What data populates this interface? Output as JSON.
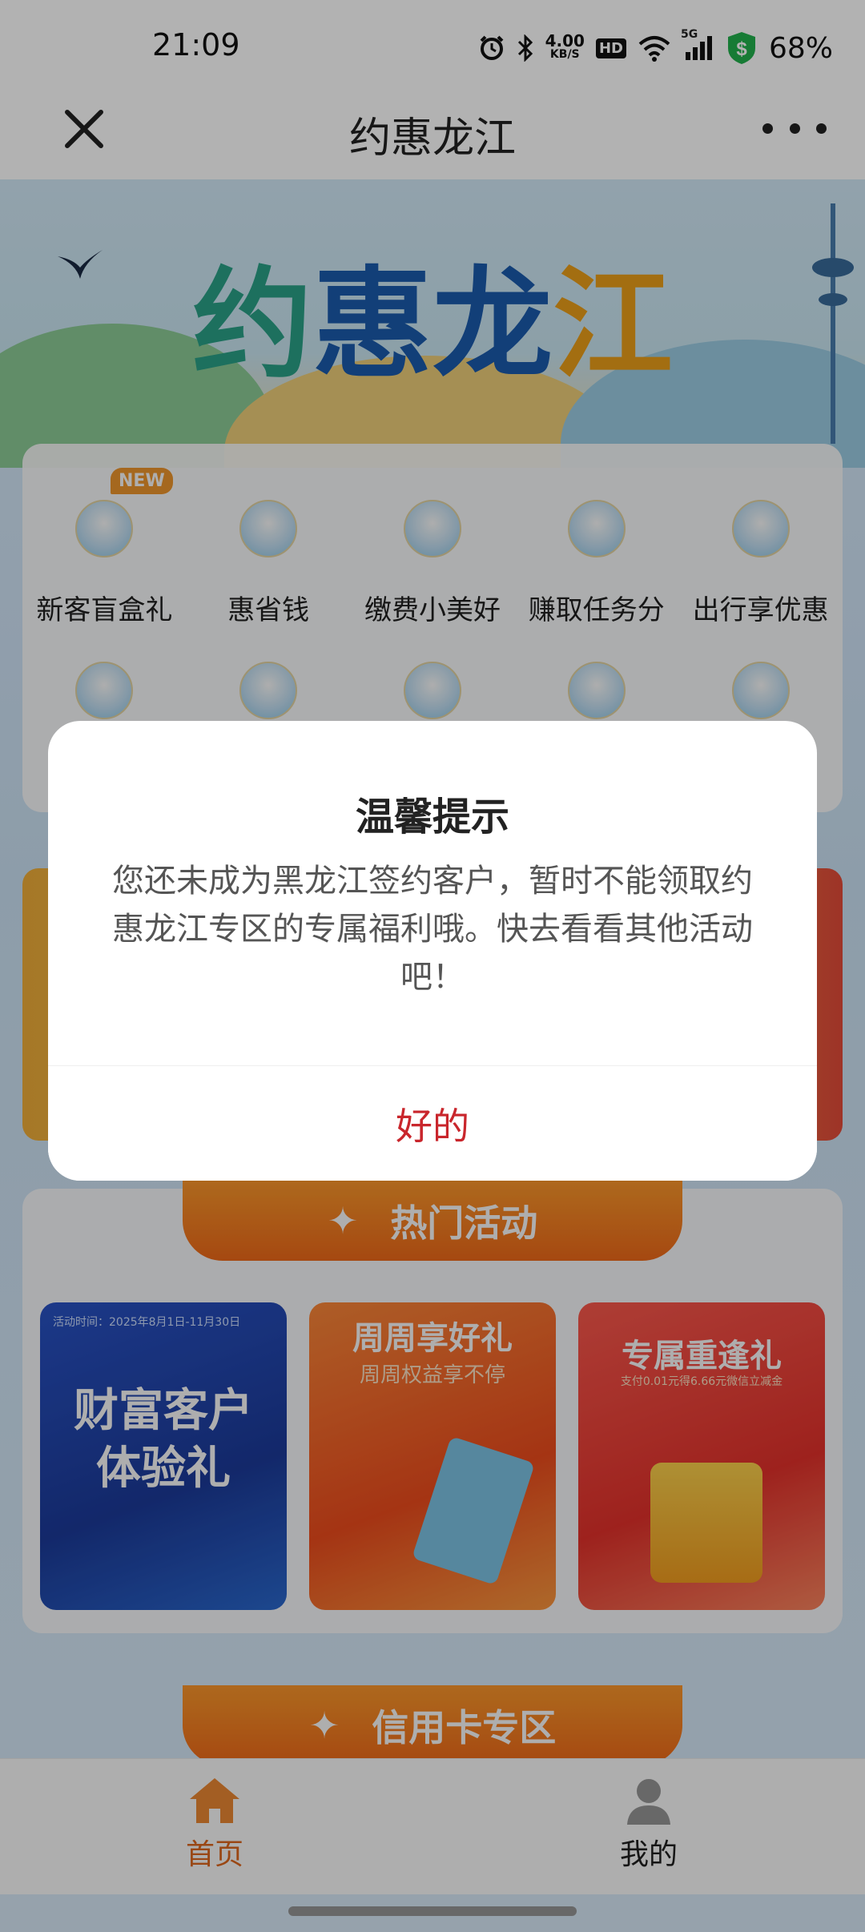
{
  "status_bar": {
    "time": "21:09",
    "net_speed_value": "4.00",
    "net_speed_unit": "KB/S",
    "hd_badge": "HD",
    "network_type": "5G",
    "battery": "68%"
  },
  "title_bar": {
    "title": "约惠龙江"
  },
  "banner": {
    "title_part1": "约",
    "title_part2": "惠龙",
    "title_part3": "江"
  },
  "quick_menu": {
    "new_badge": "NEW",
    "items": [
      {
        "label": "新客盲盒礼"
      },
      {
        "label": "惠省钱"
      },
      {
        "label": "缴费小美好"
      },
      {
        "label": "赚取任务分"
      },
      {
        "label": "出行享优惠"
      }
    ]
  },
  "hot_section": {
    "heading": "热门活动",
    "promos": [
      {
        "subtitle": "活动时间：2025年8月1日-11月30日",
        "title": "财富客户体验礼"
      },
      {
        "title": "周周享好礼",
        "subtitle": "周周权益享不停"
      },
      {
        "title": "专属重逢礼",
        "subtitle": "支付0.01元得6.66元微信立减金"
      }
    ]
  },
  "credit_section": {
    "heading": "信用卡专区"
  },
  "bottom_nav": {
    "home_label": "首页",
    "mine_label": "我的"
  },
  "dialog": {
    "title": "温馨提示",
    "message": "您还未成为黑龙江签约客户，暂时不能领取约惠龙江专区的专属福利哦。快去看看其他活动吧！",
    "confirm_label": "好的"
  },
  "colors": {
    "accent_orange": "#f36b1a",
    "dialog_button_red": "#c9262c",
    "nav_active": "#e2691f"
  }
}
